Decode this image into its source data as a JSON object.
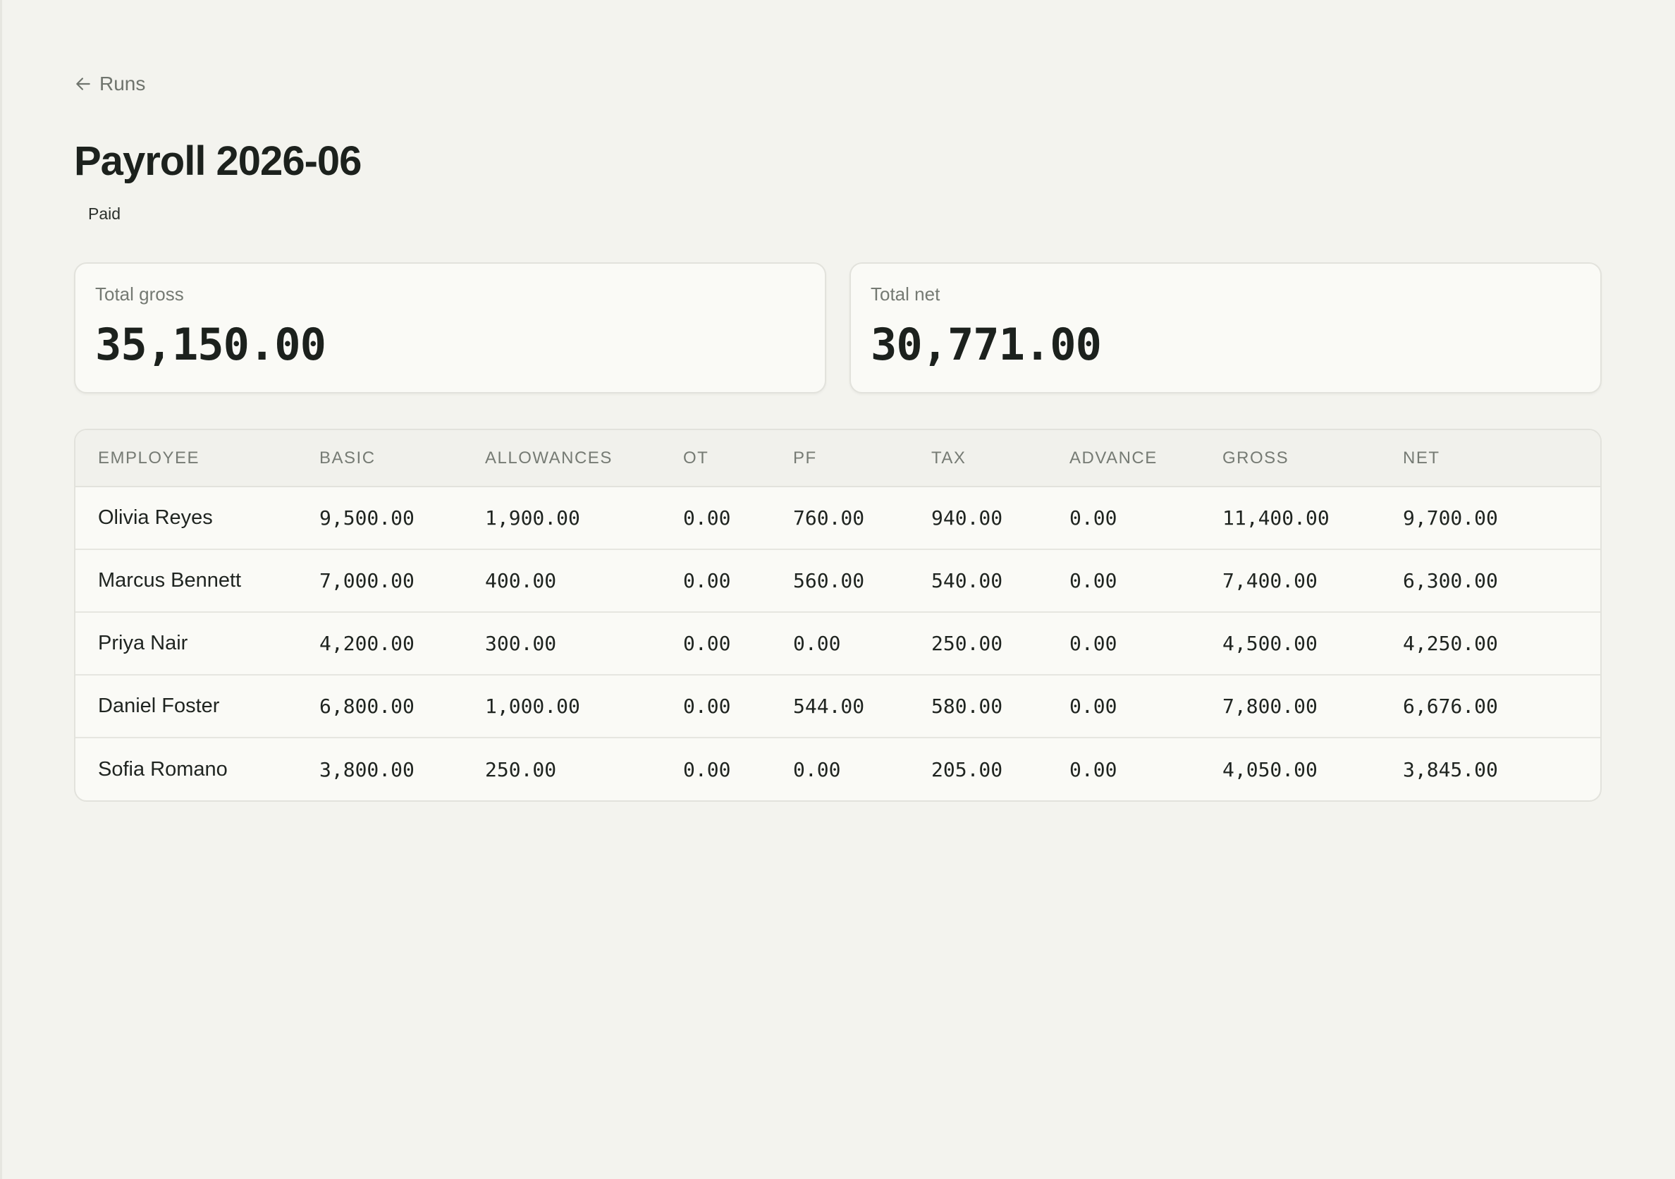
{
  "nav": {
    "back_label": "Runs"
  },
  "header": {
    "title": "Payroll 2026-06",
    "status": "Paid"
  },
  "summary": {
    "gross_label": "Total gross",
    "gross_value": "35,150.00",
    "net_label": "Total net",
    "net_value": "30,771.00"
  },
  "table": {
    "columns": [
      "EMPLOYEE",
      "BASIC",
      "ALLOWANCES",
      "OT",
      "PF",
      "TAX",
      "ADVANCE",
      "GROSS",
      "NET"
    ],
    "rows": [
      [
        "Olivia Reyes",
        "9,500.00",
        "1,900.00",
        "0.00",
        "760.00",
        "940.00",
        "0.00",
        "11,400.00",
        "9,700.00"
      ],
      [
        "Marcus Bennett",
        "7,000.00",
        "400.00",
        "0.00",
        "560.00",
        "540.00",
        "0.00",
        "7,400.00",
        "6,300.00"
      ],
      [
        "Priya Nair",
        "4,200.00",
        "300.00",
        "0.00",
        "0.00",
        "250.00",
        "0.00",
        "4,500.00",
        "4,250.00"
      ],
      [
        "Daniel Foster",
        "6,800.00",
        "1,000.00",
        "0.00",
        "544.00",
        "580.00",
        "0.00",
        "7,800.00",
        "6,676.00"
      ],
      [
        "Sofia Romano",
        "3,800.00",
        "250.00",
        "0.00",
        "0.00",
        "205.00",
        "0.00",
        "4,050.00",
        "3,845.00"
      ]
    ]
  }
}
